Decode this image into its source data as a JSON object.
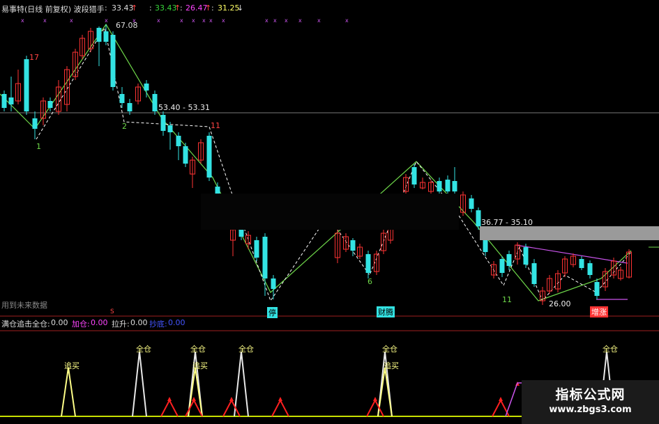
{
  "header": {
    "title": "易事特(日线 前复权) 波段猎手",
    "sep": ":",
    "v1": "33.43",
    "v2": "33.43",
    "v3": "26.47",
    "v4": "31.25",
    "up_arrow": "↑",
    "down_arrow": "↓",
    "v1_color": "#dddddd",
    "v2_color": "#37d63a",
    "v3_color": "#ff44ff",
    "v4_color": "#ffff66"
  },
  "subheader": {
    "title": "满仓追击",
    "full_label": "全仓:",
    "full_value": "0.00",
    "add_label": "加仓:",
    "add_value": "0.00",
    "pull_label": "拉升:",
    "pull_value": "0.00",
    "buy_label": "抄底:",
    "buy_value": "0.00"
  },
  "annotations": {
    "peak_price": "67.08",
    "band1": "53.40 - 53.31",
    "band2": "36.77 - 35.10",
    "low_price": "26.00",
    "future_data": "用到未来数据",
    "num_17": "17",
    "num_1": "1",
    "num_2": "2",
    "num_11a": "11",
    "num_6": "6",
    "num_11b": "11",
    "marker_stop": "停",
    "marker_wealth": "财腾",
    "marker_growth": "增涨",
    "marker_s": "S"
  },
  "signals": {
    "chase": "追买",
    "full": "全仓"
  },
  "watermark": {
    "title": "指标公式网",
    "url": "www.zbgs3.com"
  },
  "colors": {
    "bull": "#ff3333",
    "bear": "#33e3e3",
    "trend": "#6fd84a",
    "dash": "#ffffff",
    "signal_white": "#e8e8e8",
    "signal_yellow": "#ffff88",
    "signal_red": "#ff2020",
    "baseline": "#c8e000",
    "purple": "#cc55ee"
  }
}
